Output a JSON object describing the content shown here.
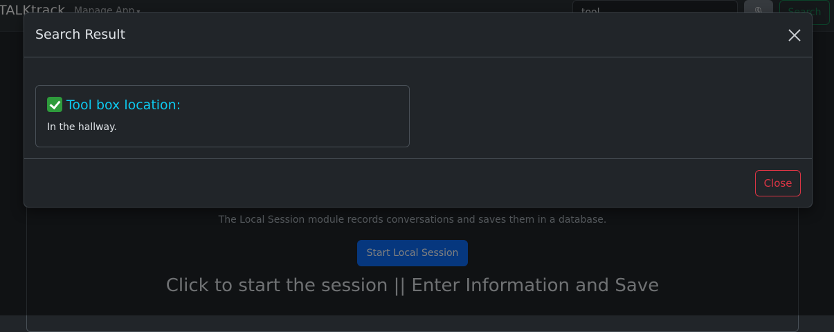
{
  "navbar": {
    "brand": "TALKtrack",
    "dropdown_label": "Manage App",
    "search": {
      "value": "tool",
      "placeholder": ""
    },
    "mic_icon": "microphone-icon",
    "search_label": "Search"
  },
  "page": {
    "module_description": "The Local Session module records conversations and saves them in a database.",
    "start_button_label": "Start Local Session",
    "session_heading": "Click to start the session || Enter Information and Save"
  },
  "modal": {
    "title": "Search Result",
    "close_icon": "close-icon",
    "result": {
      "icon": "check-mark-icon",
      "title": "Tool box location:",
      "text": "In the hallway."
    },
    "close_label": "Close"
  },
  "colors": {
    "accent_cyan": "#0dcaf0",
    "danger": "#dc3545",
    "primary": "#0d6efd",
    "success": "#198754",
    "background": "#212529"
  }
}
